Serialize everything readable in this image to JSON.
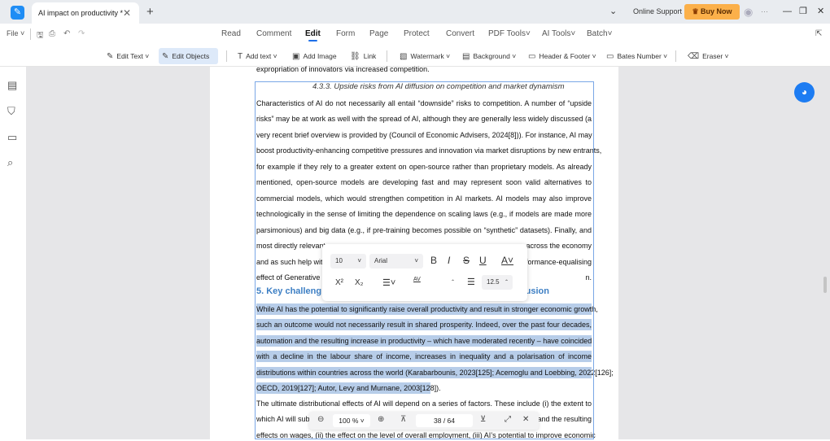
{
  "titlebar": {
    "tab_title": "AI impact on productivity *",
    "online_support": "Online Support",
    "buy_now": "Buy Now"
  },
  "menubar": {
    "file": "File",
    "items": [
      "Read",
      "Comment",
      "Edit",
      "Form",
      "Page",
      "Protect",
      "Convert",
      "PDF Tools",
      "AI Tools",
      "Batch"
    ],
    "active": "Edit"
  },
  "toolbar": {
    "edit_text": "Edit Text",
    "edit_objects": "Edit Objects",
    "add_text": "Add text",
    "add_image": "Add Image",
    "link": "Link",
    "watermark": "Watermark",
    "background": "Background",
    "header_footer": "Header & Footer",
    "bates_number": "Bates Number",
    "eraser": "Eraser"
  },
  "document": {
    "top_line": "expropriation of innovators via increased competition.",
    "subheading": "4.3.3.  Upside risks from AI diffusion on competition and market dynamism",
    "para1": [
      {
        "text": "Characteristics of AI do not necessarily all entail “downside” risks to competition.  A number of “upside"
      },
      {
        "text": "risks” may be at work as well with the spread of AI, although they are generally less widely discussed (a"
      },
      {
        "text": "very recent brief overview is provided by (Council of Economic Advisers, 2024[8])). For instance, AI may"
      },
      {
        "text": "boost productivity-enhancing competitive pressures and innovation via market disruptions by new entrants,"
      },
      {
        "text": "for example if they rely to a greater extent on open-source rather than proprietary models. As already"
      },
      {
        "text": "mentioned, open-source models are developing fast and may represent soon valid alternatives to"
      },
      {
        "text": "commercial models, which would strengthen competition in AI markets. AI models may also improve"
      },
      {
        "text": "technologically in the sense of limiting the dependence on scaling laws (e.g., if models are made more"
      },
      {
        "text": "parsimonious) and big data (e.g., if pre-training becomes possible on “synthetic” datasets). Finally, and"
      },
      {
        "left": "most directly relevant",
        "right": "across the economy"
      },
      {
        "left": "and as such help wit",
        "right": "formance-equalising"
      },
      {
        "left": "effect of Generative .",
        "right": "n."
      }
    ],
    "heading5_left": "5.  Key challeng",
    "heading5_right": "usion",
    "para2": [
      "While AI has the potential to significantly raise overall productivity and result in stronger economic growth,",
      "such an outcome would not necessarily result in shared prosperity. Indeed, over the past four decades,",
      "automation and the resulting increase in productivity – which have moderated recently – have coincided",
      "with a decline in the labour share of income, increases in inequality and a polarisation of income",
      "distributions within countries across the world (Karabarbounis, 2023[125]; Acemoglu and Loebbing, 2022[126];",
      "OECD, 2019[127]; Autor, Levy and Murnane, 2003[128])."
    ],
    "para3": [
      {
        "text": "The ultimate distributional effects of AI will depend on a series of factors. These include (i) the extent to"
      },
      {
        "left": "which AI will sub",
        "right": "and the resulting"
      },
      {
        "text": "effects on wages, (ii) the effect on the level of overall employment, (iii) AI’s potential to improve economic"
      }
    ]
  },
  "format_popup": {
    "font_size": "10",
    "font_name": "Arial",
    "line_spacing": "12.5",
    "char_spacing": ""
  },
  "zoombar": {
    "zoom": "100 %",
    "page_current": "38",
    "page_total": "/ 64"
  },
  "colors": {
    "accent": "#1e6fe8",
    "selection": "#b7cde9",
    "heading": "#3d7fc4",
    "buy": "#fbb04a"
  }
}
